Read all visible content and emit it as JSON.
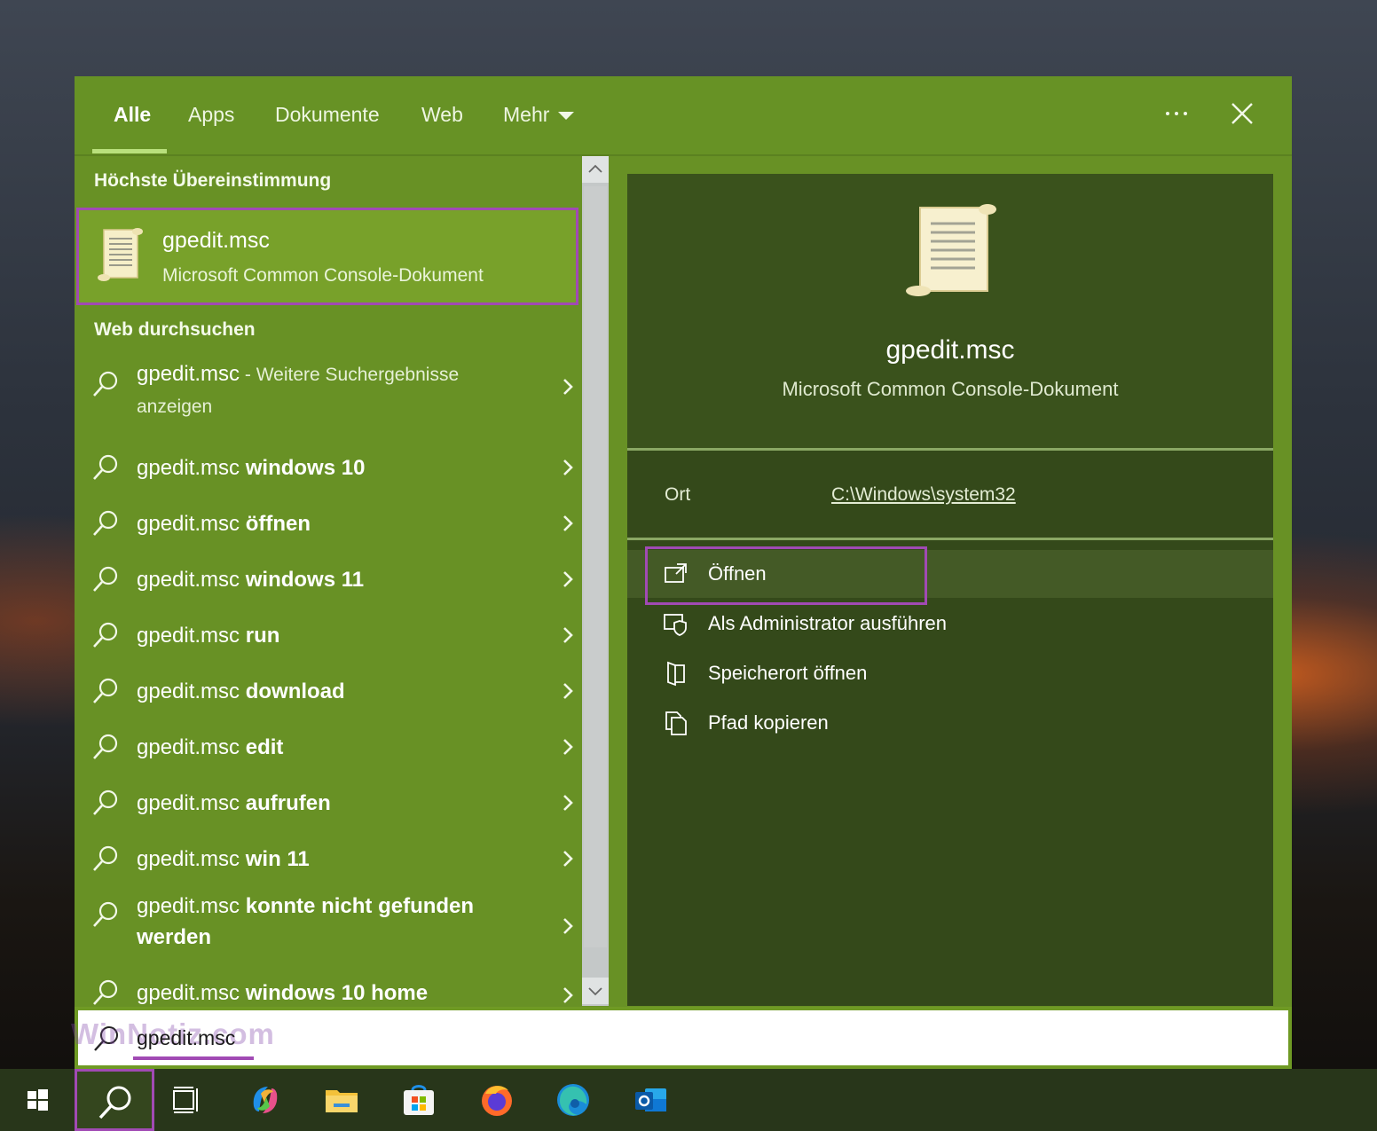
{
  "tabs": [
    {
      "label": "Alle",
      "active": true
    },
    {
      "label": "Apps"
    },
    {
      "label": "Dokumente"
    },
    {
      "label": "Web"
    },
    {
      "label": "Mehr"
    }
  ],
  "icons": {
    "more_options": "ellipsis-icon",
    "close": "close-icon",
    "search": "search-icon",
    "chevron": "chevron-right-icon",
    "document": "scroll-document-icon"
  },
  "left": {
    "best_match_heading": "Höchste Übereinstimmung",
    "best_match": {
      "title": "gpedit.msc",
      "subtitle": "Microsoft Common Console-Dokument"
    },
    "web_heading": "Web durchsuchen",
    "web_results": [
      {
        "prefix": "gpedit.msc",
        "suffix": " - Weitere Suchergebnisse anzeigen"
      },
      {
        "prefix": "gpedit.msc",
        "suffix": " windows 10"
      },
      {
        "prefix": "gpedit.msc",
        "suffix": " öffnen"
      },
      {
        "prefix": "gpedit.msc",
        "suffix": " windows 11"
      },
      {
        "prefix": "gpedit.msc",
        "suffix": " run"
      },
      {
        "prefix": "gpedit.msc",
        "suffix": " download"
      },
      {
        "prefix": "gpedit.msc",
        "suffix": " edit"
      },
      {
        "prefix": "gpedit.msc",
        "suffix": " aufrufen"
      },
      {
        "prefix": "gpedit.msc",
        "suffix": " win 11"
      },
      {
        "prefix": "gpedit.msc",
        "suffix": " konnte nicht gefunden werden"
      },
      {
        "prefix": "gpedit.msc",
        "suffix": " windows 10 home"
      }
    ]
  },
  "right": {
    "title": "gpedit.msc",
    "subtitle": "Microsoft Common Console-Dokument",
    "location_label": "Ort",
    "location_value": "C:\\Windows\\system32",
    "actions": [
      {
        "label": "Öffnen",
        "icon": "open-external-icon"
      },
      {
        "label": "Als Administrator ausführen",
        "icon": "admin-shield-icon"
      },
      {
        "label": "Speicherort öffnen",
        "icon": "folder-location-icon"
      },
      {
        "label": "Pfad kopieren",
        "icon": "copy-path-icon"
      }
    ]
  },
  "search": {
    "value": "gpedit.msc",
    "watermark": "WinNotiz.com"
  },
  "taskbar": [
    {
      "name": "start-button",
      "icon": "windows-logo-icon"
    },
    {
      "name": "search-button",
      "icon": "search-icon"
    },
    {
      "name": "task-view-button",
      "icon": "task-view-icon"
    },
    {
      "name": "copilot-button",
      "icon": "copilot-icon"
    },
    {
      "name": "file-explorer-button",
      "icon": "folder-icon"
    },
    {
      "name": "store-button",
      "icon": "store-icon"
    },
    {
      "name": "firefox-button",
      "icon": "firefox-icon"
    },
    {
      "name": "edge-button",
      "icon": "edge-icon"
    },
    {
      "name": "outlook-button",
      "icon": "outlook-icon"
    }
  ],
  "colors": {
    "panel_green": "#689125",
    "right_pane": "#34491a",
    "highlight_frame": "#a14ab4",
    "tab_indicator": "#b9e07c"
  }
}
